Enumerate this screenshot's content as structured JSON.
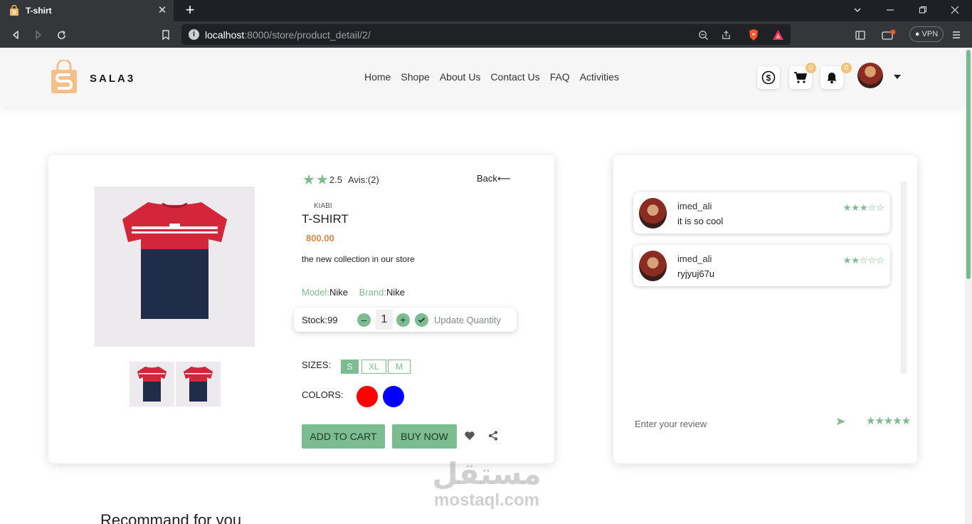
{
  "browser": {
    "tab_title": "T-shirt",
    "tab_close": "✕",
    "new_tab": "+",
    "url_host": "localhost",
    "url_path": ":8000/store/product_detail/2/",
    "vpn_label": "VPN"
  },
  "header": {
    "brand": "SALA3",
    "nav": [
      "Home",
      "Shope",
      "About Us",
      "Contact Us",
      "FAQ",
      "Activities"
    ],
    "cart_count": "0",
    "notif_count": "0"
  },
  "product": {
    "rating": "2.5",
    "avis": "Avis:(2)",
    "back": "Back⟵",
    "vendor": "KIABI",
    "name": "T-SHIRT",
    "price": "800.00",
    "description": "the new collection in our store",
    "model_label": "Model:",
    "model_value": "Nike",
    "brand_label": "Brand:",
    "brand_value": "Nike",
    "stock": "Stock:99",
    "quantity": "1",
    "update_label": "Update Quantity",
    "sizes_label": "SIZES:",
    "sizes": [
      "S",
      "XL",
      "M"
    ],
    "selected_size": "S",
    "colors_label": "COLORS:",
    "colors": [
      "#ff0000",
      "#0000ff"
    ],
    "add_to_cart": "ADD TO CART",
    "buy_now": "BUY NOW"
  },
  "reviews": {
    "items": [
      {
        "user": "imed_ali",
        "text": "it is so cool",
        "stars": "★★★☆☆"
      },
      {
        "user": "imed_ali",
        "text": "ryjyuj67u",
        "stars": "★★☆☆☆"
      }
    ],
    "input_placeholder": "Enter your review",
    "picker_stars": "★★★★★"
  },
  "recommend_title": "Recommand for you",
  "watermark": {
    "arabic": "مستقل",
    "latin": "mostaql.com"
  },
  "colors": {
    "accent": "#7dbb91",
    "price": "#d18a4a",
    "badge": "#f2c27a"
  }
}
